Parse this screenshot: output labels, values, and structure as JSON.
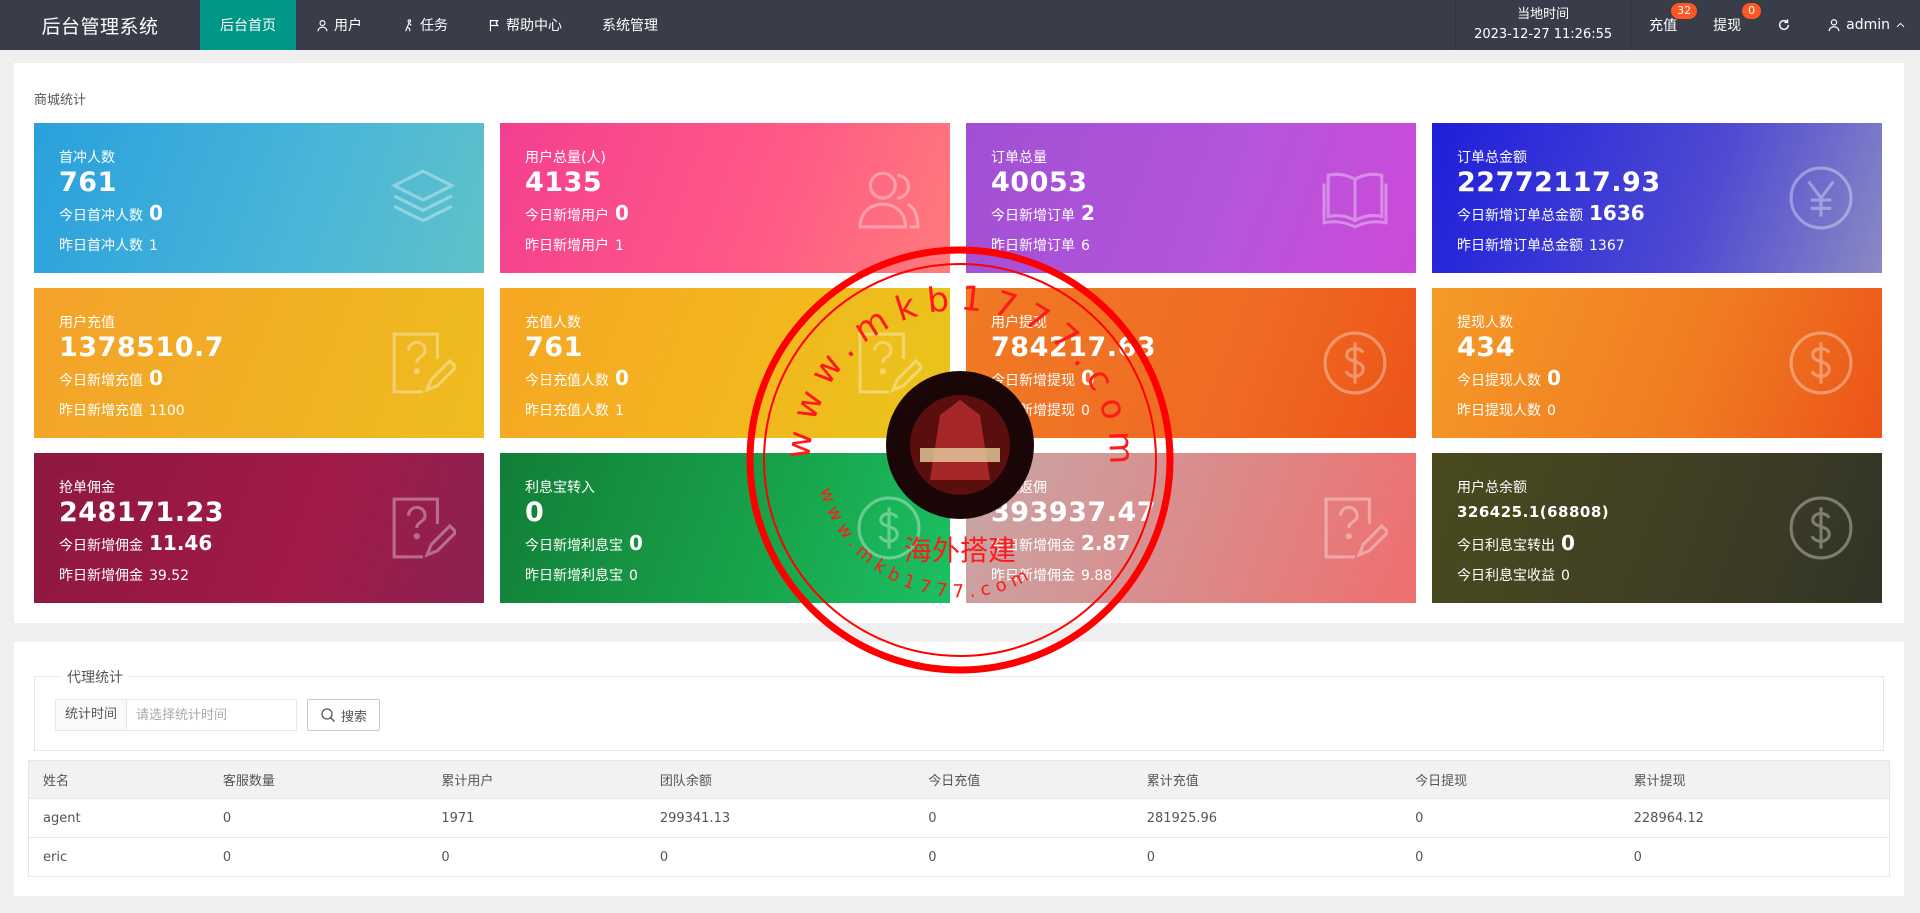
{
  "app": {
    "title": "后台管理系统"
  },
  "nav": [
    {
      "label": "后台首页",
      "icon": "home",
      "active": true
    },
    {
      "label": "用户",
      "icon": "user-icon",
      "active": false
    },
    {
      "label": "任务",
      "icon": "walk-icon",
      "active": false
    },
    {
      "label": "帮助中心",
      "icon": "flag-icon",
      "active": false
    },
    {
      "label": "系统管理",
      "icon": "",
      "active": false
    }
  ],
  "header_right": {
    "time_label": "当地时间",
    "time_value": "2023-12-27 11:26:55",
    "recharge_label": "充值",
    "recharge_badge": "32",
    "withdraw_label": "提现",
    "withdraw_badge": "0",
    "user": "admin"
  },
  "mall": {
    "title": "商城统计",
    "cards": [
      {
        "label": "首冲人数",
        "value": "761",
        "today_label": "今日首冲人数",
        "today_value": "0",
        "yest_label": "昨日首冲人数",
        "yest_value": "1",
        "icon": "layers-icon",
        "color": "#2aa0dc"
      },
      {
        "label": "用户总量(人)",
        "value": "4135",
        "today_label": "今日新增用户",
        "today_value": "0",
        "yest_label": "昨日新增用户",
        "yest_value": "1",
        "icon": "users-icon",
        "color": "#f43f90"
      },
      {
        "label": "订单总量",
        "value": "40053",
        "today_label": "今日新增订单",
        "today_value": "2",
        "yest_label": "昨日新增订单",
        "yest_value": "6",
        "icon": "book-icon",
        "color": "#a050d4"
      },
      {
        "label": "订单总金额",
        "value": "22772117.93",
        "today_label": "今日新增订单总金额",
        "today_value": "1636",
        "yest_label": "昨日新增订单总金额",
        "yest_value": "1367",
        "icon": "yen-icon",
        "color": "#1e1edb"
      },
      {
        "label": "用户充值",
        "value": "1378510.7",
        "today_label": "今日新增充值",
        "today_value": "0",
        "yest_label": "昨日新增充值",
        "yest_value": "1100",
        "icon": "question-edit-icon",
        "color": "#f4a22a"
      },
      {
        "label": "充值人数",
        "value": "761",
        "today_label": "今日充值人数",
        "today_value": "0",
        "yest_label": "昨日充值人数",
        "yest_value": "1",
        "icon": "question-edit-icon",
        "color": "#f6a623"
      },
      {
        "label": "用户提现",
        "value": "784217.63",
        "today_label": "今日新增提现",
        "today_value": "0",
        "yest_label": "昨日新增提现",
        "yest_value": "0",
        "icon": "dollar-icon",
        "color": "#f07a25"
      },
      {
        "label": "提现人数",
        "value": "434",
        "today_label": "今日提现人数",
        "today_value": "0",
        "yest_label": "昨日提现人数",
        "yest_value": "0",
        "icon": "dollar-icon",
        "color": "#f59a27"
      },
      {
        "label": "抢单佣金",
        "value": "248171.23",
        "today_label": "今日新增佣金",
        "today_value": "11.46",
        "yest_label": "昨日新增佣金",
        "yest_value": "39.52",
        "icon": "question-edit-icon",
        "color": "#8e1740"
      },
      {
        "label": "利息宝转入",
        "value": "0",
        "today_label": "今日新增利息宝",
        "today_value": "0",
        "yest_label": "昨日新增利息宝",
        "yest_value": "0",
        "icon": "dollar-icon",
        "color": "#127e37"
      },
      {
        "label": "下级返佣",
        "value": "393937.47",
        "today_label": "今日新增佣金",
        "today_value": "2.87",
        "yest_label": "昨日新增佣金",
        "yest_value": "9.88",
        "icon": "question-edit-icon",
        "color": "#de8686"
      },
      {
        "label": "用户总余额",
        "value": "326425.1(68808)",
        "today_label": "今日利息宝转出",
        "today_value": "0",
        "yest_label": "今日利息宝收益",
        "yest_value": "0",
        "icon": "dollar-icon",
        "color": "#4a4a1e"
      }
    ]
  },
  "agent": {
    "legend": "代理统计",
    "search_label": "统计时间",
    "search_placeholder": "请选择统计时间",
    "search_button": "搜索",
    "columns": [
      "姓名",
      "客服数量",
      "累计用户",
      "团队余额",
      "今日充值",
      "累计充值",
      "今日提现",
      "累计提现"
    ],
    "rows": [
      [
        "agent",
        "0",
        "1971",
        "299341.13",
        "0",
        "281925.96",
        "0",
        "228964.12"
      ],
      [
        "eric",
        "0",
        "0",
        "0",
        "0",
        "0",
        "0",
        "0"
      ]
    ]
  },
  "watermark": {
    "url_text": "www.mkb1777.com",
    "center_text": "海外搭建"
  }
}
